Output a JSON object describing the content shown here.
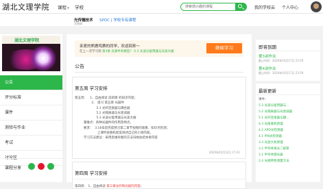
{
  "topbar": {
    "logo": "湖北文理学院",
    "nav": [
      {
        "label": "课程"
      },
      {
        "label": "学校"
      }
    ],
    "search_placeholder": "搜索感兴趣的课程",
    "my_school": "我的学校云",
    "personal_center": "个人中心"
  },
  "course": {
    "name": "光传输技术",
    "spoc_label": "SPOC | 学校专有课程",
    "sub": "学期课"
  },
  "sidebar": {
    "banner_text": "湖北文理学院",
    "menu": [
      {
        "label": "公告"
      },
      {
        "label": "评分标准"
      },
      {
        "label": "课件"
      },
      {
        "label": "测验与作业"
      },
      {
        "label": "考试"
      },
      {
        "label": "讨论区"
      }
    ],
    "share_label": "课程分享"
  },
  "main": {
    "welcome_line1": "亲爱的熊鹿鸣赛的同学，欢迎回来～",
    "welcome_line2_prefix": "在上一次学习到",
    "welcome_line2_link": "第3讲 光源件有哪些？-5.3 光波分复用器与光波大嫂",
    "study_button": "继续学习",
    "section_title": "公告",
    "announcements": [
      {
        "title": "第五周 学习安排",
        "body": "第五周：   1、自由阅读 前四章 的知识内容；\n                 2、 提习 第五章 光器件\n                      5.1 光纤连接器与耦合器\n                      5.2 光隔离器与光衰减器\n                      5.3 光波分复用器与光波大嫂\n         重难点：各种光器件的作用及特点。\n         要求：  3.18日前完成预习第二章节视频的观看、知识点检测；\n                       上课时会随机提案讲述自己的小调内容。\n         学习方法建议：采用思维导图的方法归纳总结本章内容",
        "time": "2020年03月12日 17:41"
      },
      {
        "title": "第四周 学习安排",
        "snippet_prefix": "第四周：   1、自由阅读 ",
        "snippet_red": "第三章光纤和光缆的内容",
        "snippet_suffix": "；"
      }
    ]
  },
  "right": {
    "due_title": "即将到期",
    "due": [
      {
        "name": "第3讲作业",
        "date": "截止时间：2020年03月17日 23:59"
      },
      {
        "name": "第4讲作业",
        "date": "截止时间：2020年03月17日 23:59"
      }
    ],
    "updates_title": "最新更新",
    "updates_caption": "课件：",
    "updates": [
      "5.3 光波分复用器与...",
      "5.2 光隔离器与光衰减器",
      "5.1 光纤连接器与耦...",
      "4.3 光接收机原理",
      "4.2 APD光检测器",
      "4.1 PIN光检测器",
      "3.3 光放大机原理",
      "3.2 半导体发光二极管",
      "3.1 半导体激光器",
      "2.4 光缆特性测量方法"
    ]
  },
  "colors": {
    "accent": "#2db64a",
    "orange": "#ff7a1a",
    "link_blue": "#2b7bd8"
  }
}
